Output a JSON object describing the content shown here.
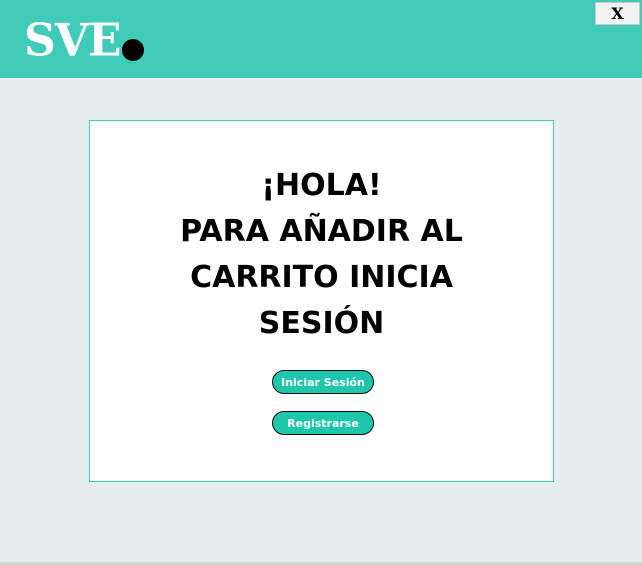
{
  "header": {
    "logo_text": "SVE",
    "close_label": "X"
  },
  "card": {
    "message_lines": [
      "¡HOLA!",
      "PARA AÑADIR AL",
      "CARRITO INICIA",
      "SESIÓN"
    ],
    "login_label": "Iniciar Sesión",
    "register_label": "Registrarse"
  },
  "colors": {
    "header_bg": "#40cab8",
    "button_bg": "#1ec6aa",
    "window_bg": "#e6eeed"
  }
}
